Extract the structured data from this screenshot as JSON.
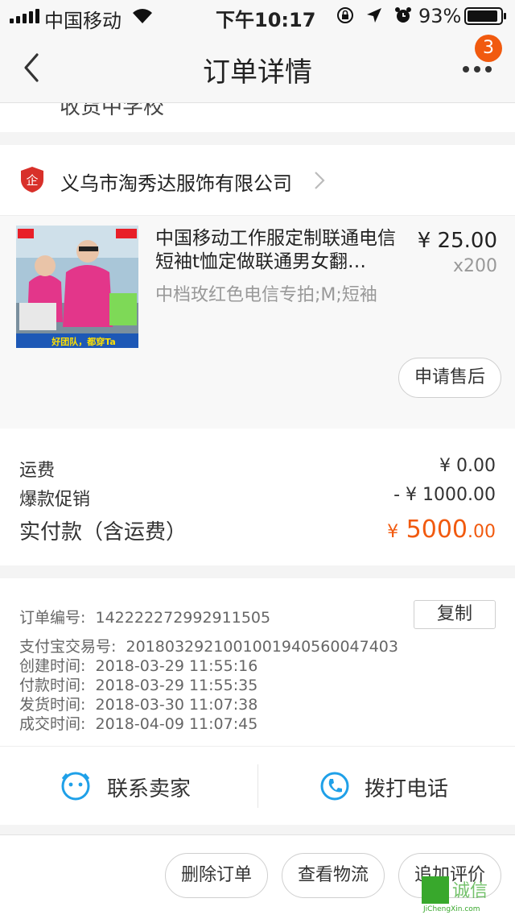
{
  "status_bar": {
    "carrier": "中国移动",
    "time": "下午10:17",
    "battery_percent": "93%",
    "battery_level": 0.93
  },
  "nav": {
    "title": "订单详情",
    "badge": "3"
  },
  "partial_text": "收货中学校",
  "shop": {
    "name": "义乌市淘秀达服饰有限公司"
  },
  "product": {
    "title": "中国移动工作服定制联通电信短袖t恤定做联通男女翻…",
    "price": "¥ 25.00",
    "quantity": "x200",
    "spec": "中档玫红色电信专拍;M;短袖",
    "image_text": "好团队，都穿Ta",
    "after_sale_label": "申请售后"
  },
  "fees": {
    "shipping_label": "运费",
    "shipping_value": "¥ 0.00",
    "promo_label": "爆款促销",
    "promo_value": "- ¥ 1000.00",
    "paid_label": "实付款（含运费）",
    "paid_currency": "¥",
    "paid_int": "5000",
    "paid_dec": ".00"
  },
  "order_info": {
    "order_no_label": "订单编号:",
    "order_no": "1422222729929115​05",
    "copy_label": "复制",
    "alipay_label": "支付宝交易号:",
    "alipay_no": "2018032921001001940560047403",
    "created_label": "创建时间:",
    "created": "2018-03-29 11:55:16",
    "paid_label": "付款时间:",
    "paid": "2018-03-29 11:55:35",
    "shipped_label": "发货时间:",
    "shipped": "2018-03-30 11:07:38",
    "completed_label": "成交时间:",
    "completed": "2018-04-09 11:07:45"
  },
  "contact": {
    "seller_label": "联系卖家",
    "phone_label": "拨打电话"
  },
  "actions": {
    "delete_label": "删除订单",
    "logistics_label": "查看物流",
    "review_label": "追加评价"
  },
  "watermark": {
    "text": "诚信",
    "url": "JiChengXin.com"
  },
  "colors": {
    "accent": "#f15a0f",
    "contact_icon": "#1fa0e8",
    "shop_badge": "#d8302a"
  }
}
